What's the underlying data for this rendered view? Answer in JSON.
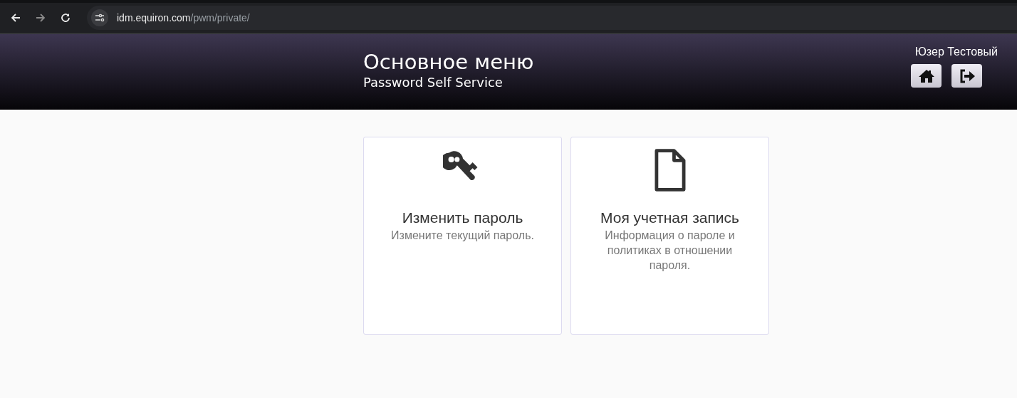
{
  "browser": {
    "url_host": "idm.equiron.com",
    "url_path": "/pwm/private/"
  },
  "header": {
    "title": "Основное меню",
    "subtitle": "Password Self Service",
    "user": "Юзер Тестовый"
  },
  "header_buttons": [
    {
      "kind": "home"
    },
    {
      "kind": "logout"
    }
  ],
  "tiles": [
    {
      "kind": "key",
      "title": "Изменить пароль",
      "description": "Измените текущий пароль."
    },
    {
      "kind": "document",
      "title": "Моя учетная запись",
      "description": "Информация о пароле и политиках в отношении пароля."
    }
  ]
}
